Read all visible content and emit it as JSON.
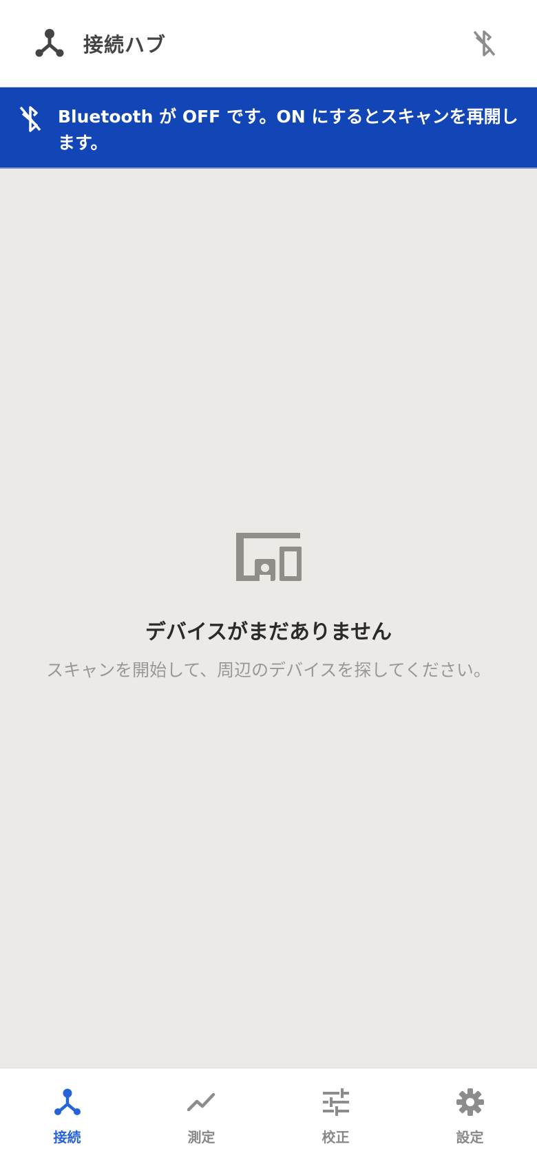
{
  "header": {
    "title": "接続ハブ",
    "icons": {
      "app": "hub-icon",
      "bluetooth": "bluetooth-disabled-icon"
    }
  },
  "banner": {
    "message": "Bluetooth が OFF です。ON にするとスキャンを再開します。",
    "icon": "bluetooth-disabled-icon",
    "background": "#1245b5"
  },
  "empty_state": {
    "icon": "devices-icon",
    "title": "デバイスがまだありません",
    "subtitle": "スキャンを開始して、周辺のデバイスを探してください。"
  },
  "bottom_nav": {
    "active_color": "#2563d8",
    "items": [
      {
        "label": "接続",
        "icon": "hub-icon",
        "active": true
      },
      {
        "label": "測定",
        "icon": "trend-line-icon",
        "active": false
      },
      {
        "label": "校正",
        "icon": "tune-sliders-icon",
        "active": false
      },
      {
        "label": "設定",
        "icon": "gear-icon",
        "active": false
      }
    ]
  }
}
